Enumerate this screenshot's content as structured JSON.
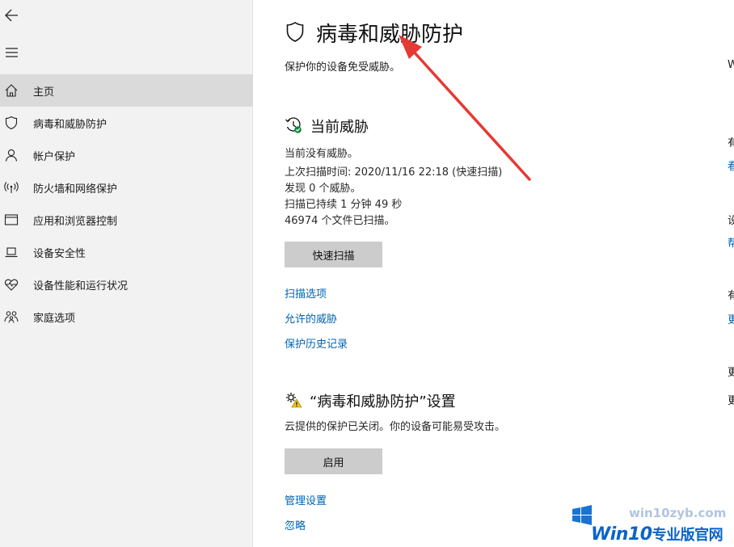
{
  "sidebar": {
    "back_icon": "back-arrow-icon",
    "menu_icon": "hamburger-icon",
    "items": [
      {
        "label": "主页",
        "icon": "home-icon",
        "active": true
      },
      {
        "label": "病毒和威胁防护",
        "icon": "shield-icon",
        "active": false
      },
      {
        "label": "帐户保护",
        "icon": "person-icon",
        "active": false
      },
      {
        "label": "防火墙和网络保护",
        "icon": "wifi-antenna-icon",
        "active": false
      },
      {
        "label": "应用和浏览器控制",
        "icon": "browser-window-icon",
        "active": false
      },
      {
        "label": "设备安全性",
        "icon": "laptop-icon",
        "active": false
      },
      {
        "label": "设备性能和运行状况",
        "icon": "heart-pulse-icon",
        "active": false
      },
      {
        "label": "家庭选项",
        "icon": "family-icon",
        "active": false
      }
    ]
  },
  "main": {
    "title": "病毒和威胁防护",
    "subtitle": "保护你的设备免受威胁。",
    "current_threats": {
      "title": "当前威胁",
      "lines": [
        "当前没有威胁。",
        "上次扫描时间: 2020/11/16 22:18 (快速扫描)",
        "发现 0 个威胁。",
        "扫描已持续 1 分钟 49 秒",
        "46974 个文件已扫描。"
      ],
      "quick_scan_button": "快速扫描",
      "links": [
        "扫描选项",
        "允许的威胁",
        "保护历史记录"
      ]
    },
    "settings": {
      "title": "“病毒和威胁防护”设置",
      "description": "云提供的保护已关闭。你的设备可能易受攻击。",
      "enable_button": "启用",
      "links": [
        "管理设置",
        "忽略"
      ]
    }
  },
  "right_column": {
    "fragments": [
      "W",
      "有",
      "看",
      "设",
      "帮",
      "有",
      "更",
      "更",
      "更"
    ]
  },
  "watermark": {
    "url": "win10zyb.com",
    "brand": "Win10",
    "brand_suffix": "专业版官网"
  },
  "colors": {
    "sidebar_bg": "#f2f2f2",
    "active_item_bg": "#dadada",
    "button_bg": "#cccccc",
    "link": "#0063b1",
    "arrow": "#e53935",
    "check_green": "#10893e",
    "warning_yellow": "#f2c811"
  }
}
